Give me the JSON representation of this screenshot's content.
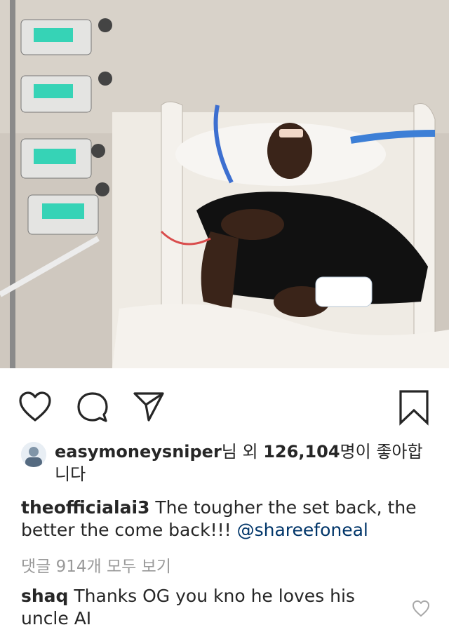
{
  "post": {
    "image_alt": "hospital bed photo",
    "icons": {
      "like": "heart-icon",
      "comment": "comment-bubble-icon",
      "share": "paper-plane-icon",
      "save": "bookmark-icon"
    },
    "likes": {
      "user": "easymoneysniper",
      "text_mid": "님 외 ",
      "count": "126,104",
      "text_end": "명이 좋아합니다"
    },
    "caption": {
      "user": "theofficialai3",
      "text": " The tougher the set back, the better the come back!!! ",
      "mention": "@shareefoneal"
    },
    "view_all_comments": "댓글 914개 모두 보기",
    "comments": [
      {
        "user": "shaq",
        "text": " Thanks OG you kno he loves his uncle AI"
      }
    ],
    "colors": {
      "text": "#262626",
      "muted": "#999999",
      "mention": "#003569"
    }
  }
}
